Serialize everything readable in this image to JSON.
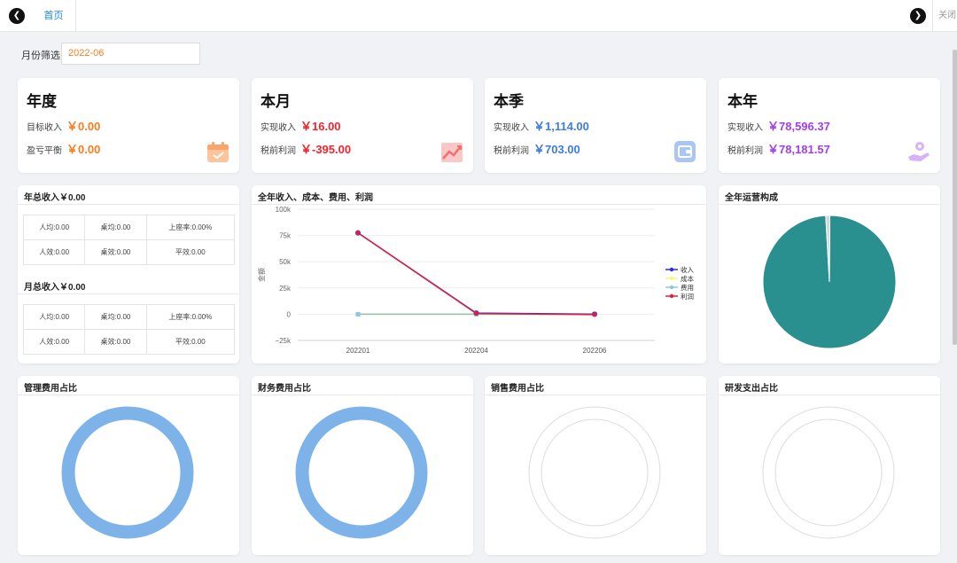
{
  "tabbar": {
    "home_label": "首页",
    "close_label": "关闭"
  },
  "filter": {
    "label": "月份筛选",
    "value": "2022-06"
  },
  "cards": {
    "annual": {
      "title": "年度",
      "row1_label": "目标收入",
      "row1_value": "￥0.00",
      "row2_label": "盈亏平衡",
      "row2_value": "￥0.00",
      "icon": "calendar-icon"
    },
    "month": {
      "title": "本月",
      "row1_label": "实现收入",
      "row1_value": "￥16.00",
      "row2_label": "税前利润",
      "row2_value": "￥-395.00",
      "icon": "trend-chart-icon"
    },
    "quarter": {
      "title": "本季",
      "row1_label": "实现收入",
      "row1_value": "￥1,114.00",
      "row2_label": "税前利润",
      "row2_value": "￥703.00",
      "icon": "wallet-icon"
    },
    "year": {
      "title": "本年",
      "row1_label": "实现收入",
      "row1_value": "￥78,596.37",
      "row2_label": "税前利润",
      "row2_value": "￥78,181.57",
      "icon": "hand-coin-icon"
    }
  },
  "income_panel": {
    "annual_title": "年总收入￥0.00",
    "annual_table": [
      [
        "人均:0.00",
        "桌均:0.00",
        "上座率:0.00%"
      ],
      [
        "人效:0.00",
        "桌效:0.00",
        "平效:0.00"
      ]
    ],
    "monthly_title": "月总收入￥0.00",
    "monthly_table": [
      [
        "人均:0.00",
        "桌均:0.00",
        "上座率:0.00%"
      ],
      [
        "人效:0.00",
        "桌效:0.00",
        "平效:0.00"
      ]
    ]
  },
  "line_panel": {
    "title": "全年收入、成本、费用、利润"
  },
  "pie_panel": {
    "title": "全年运营构成"
  },
  "donut_panels": {
    "mgmt": "管理费用占比",
    "finance": "财务费用占比",
    "sales": "销售费用占比",
    "rnd": "研发支出占比"
  },
  "colors": {
    "income": "#2a2ae8",
    "cost": "#f7f779",
    "expense": "#8cc5e6",
    "profit": "#e0203a",
    "pie_teal": "#2a8f8f",
    "donut_blue": "#7db3e8",
    "orange": "#ff7b1c"
  },
  "chart_data": [
    {
      "type": "line",
      "title": "全年收入、成本、费用、利润",
      "ylabel": "金额",
      "x": [
        "202201",
        "202204",
        "202206"
      ],
      "ylim": [
        -25000,
        100000
      ],
      "yticks": [
        "100k",
        "75k",
        "50k",
        "25k",
        "0",
        "−25k"
      ],
      "series": [
        {
          "name": "收入",
          "values": [
            77500,
            1114,
            16
          ]
        },
        {
          "name": "成本",
          "values": [
            0,
            0,
            0
          ]
        },
        {
          "name": "费用",
          "values": [
            0,
            0,
            0
          ]
        },
        {
          "name": "利润",
          "values": [
            77500,
            703,
            -395
          ]
        }
      ],
      "legend": "right"
    },
    {
      "type": "pie",
      "title": "全年运营构成",
      "slices": [
        {
          "name": "",
          "value": 99
        },
        {
          "name": "",
          "value": 1
        }
      ]
    }
  ]
}
